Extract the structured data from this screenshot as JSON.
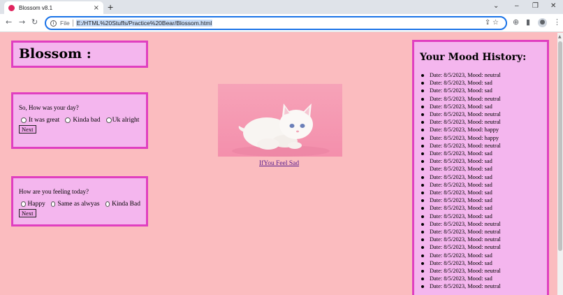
{
  "browser": {
    "tab_title": "Blossom v8.1",
    "tab_close": "×",
    "new_tab": "+",
    "omnibox": {
      "scheme": "File",
      "url": "E:/HTML%20Stuffs/Practice%20Bear/Blossom.html"
    },
    "window_controls": [
      "⌄",
      "–",
      "❐",
      "✕"
    ]
  },
  "page": {
    "title": "Blossom :",
    "q1": {
      "question": "So, How was your day?",
      "options": [
        "It was great",
        "Kinda bad",
        "Uk alright"
      ],
      "button": "Next"
    },
    "q2": {
      "question": "How are you feeling today?",
      "options": [
        "Happy",
        "Same as alwyas",
        "Kinda Bad"
      ],
      "button": "Next"
    },
    "image_link": "IfYou Feel Sad",
    "mood_history": {
      "title": "Your Mood History:",
      "entries": [
        "Date: 8/5/2023, Mood: neutral",
        "Date: 8/5/2023, Mood: sad",
        "Date: 8/5/2023, Mood: sad",
        "Date: 8/5/2023, Mood: neutral",
        "Date: 8/5/2023, Mood: sad",
        "Date: 8/5/2023, Mood: neutral",
        "Date: 8/5/2023, Mood: neutral",
        "Date: 8/5/2023, Mood: happy",
        "Date: 8/5/2023, Mood: happy",
        "Date: 8/5/2023, Mood: neutral",
        "Date: 8/5/2023, Mood: sad",
        "Date: 8/5/2023, Mood: sad",
        "Date: 8/5/2023, Mood: sad",
        "Date: 8/5/2023, Mood: sad",
        "Date: 8/5/2023, Mood: sad",
        "Date: 8/5/2023, Mood: sad",
        "Date: 8/5/2023, Mood: sad",
        "Date: 8/5/2023, Mood: sad",
        "Date: 8/5/2023, Mood: sad",
        "Date: 8/5/2023, Mood: neutral",
        "Date: 8/5/2023, Mood: neutral",
        "Date: 8/5/2023, Mood: neutral",
        "Date: 8/5/2023, Mood: neutral",
        "Date: 8/5/2023, Mood: sad",
        "Date: 8/5/2023, Mood: sad",
        "Date: 8/5/2023, Mood: neutral",
        "Date: 8/5/2023, Mood: sad",
        "Date: 8/5/2023, Mood: neutral"
      ]
    }
  },
  "colors": {
    "background": "#fbbcbf",
    "panel": "#f4b6ee",
    "panel_border": "#e03fc0",
    "omnibox_border": "#1a73e8"
  }
}
